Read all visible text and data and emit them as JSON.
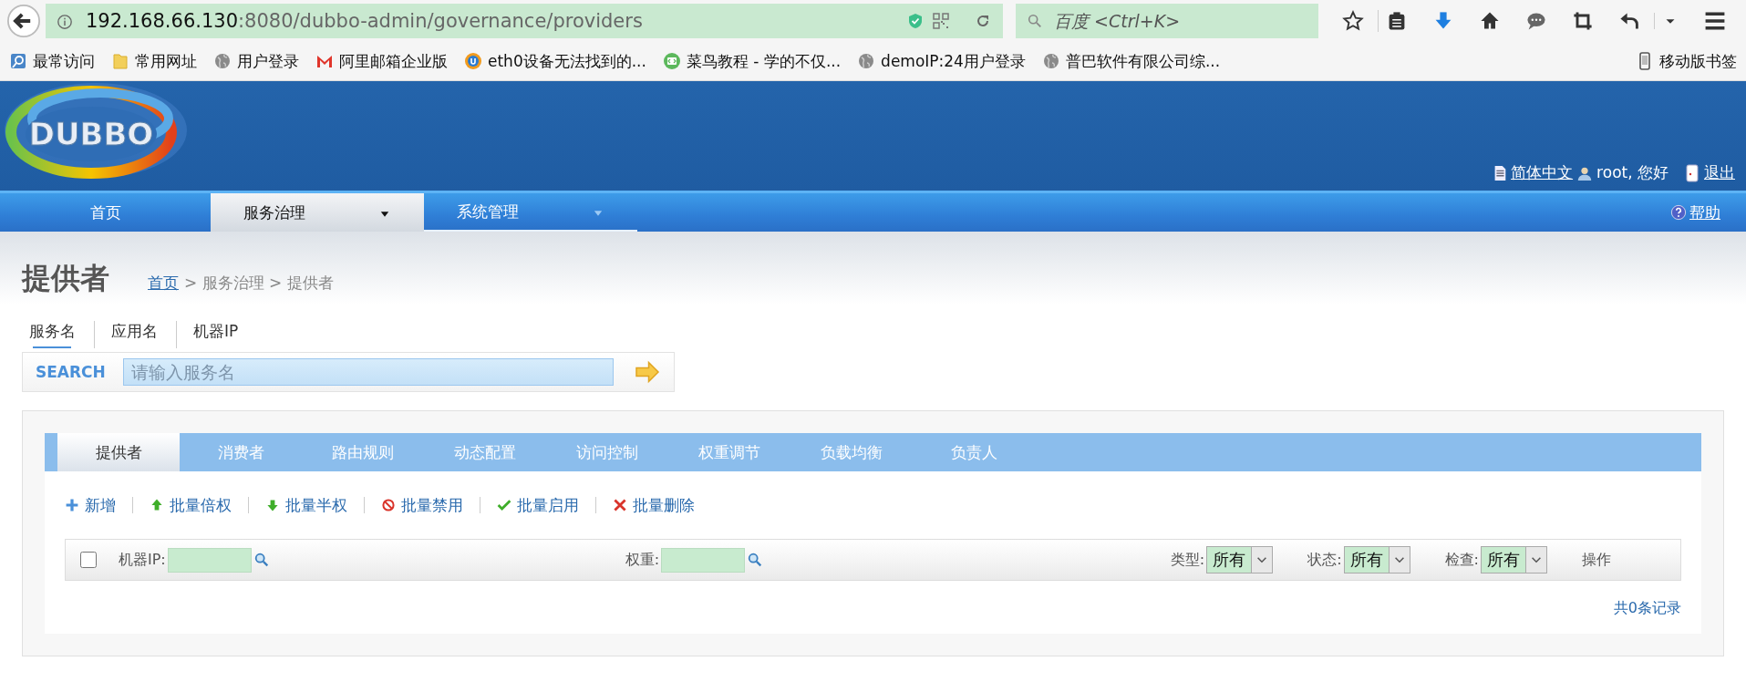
{
  "browser": {
    "url_host": "192.168.66.130",
    "url_rest": ":8080/dubbo-admin/governance/providers",
    "search_placeholder": "百度 <Ctrl+K>",
    "bookmarks": [
      {
        "label": "最常访问",
        "kind": "frequent"
      },
      {
        "label": "常用网址",
        "kind": "folder"
      },
      {
        "label": "用户登录",
        "kind": "globe"
      },
      {
        "label": "阿里邮箱企业版",
        "kind": "mail"
      },
      {
        "label": "eth0设备无法找到的...",
        "kind": "badge"
      },
      {
        "label": "菜鸟教程 - 学的不仅...",
        "kind": "code"
      },
      {
        "label": "demoIP:24用户登录",
        "kind": "globe"
      },
      {
        "label": "普巴软件有限公司综...",
        "kind": "globe"
      }
    ],
    "mobile_bookmarks": "移动版书签"
  },
  "header": {
    "logo": "DUBBO",
    "language": "简体中文",
    "user": "root, 您好",
    "logout": "退出"
  },
  "nav": {
    "items": [
      {
        "label": "首页",
        "selected": false,
        "dropdown": false
      },
      {
        "label": "服务治理",
        "selected": true,
        "dropdown": true
      },
      {
        "label": "系统管理",
        "selected": false,
        "dropdown": true
      }
    ],
    "help": "帮助"
  },
  "page": {
    "title": "提供者",
    "breadcrumb_link": "首页",
    "breadcrumb_rest": "> 服务治理 > 提供者"
  },
  "search": {
    "tabs": [
      {
        "label": "服务名",
        "selected": true
      },
      {
        "label": "应用名",
        "selected": false
      },
      {
        "label": "机器IP",
        "selected": false
      }
    ],
    "label": "SEARCH",
    "placeholder": "请输入服务名"
  },
  "tabs": [
    {
      "label": "提供者",
      "selected": true
    },
    {
      "label": "消费者",
      "selected": false
    },
    {
      "label": "路由规则",
      "selected": false
    },
    {
      "label": "动态配置",
      "selected": false
    },
    {
      "label": "访问控制",
      "selected": false
    },
    {
      "label": "权重调节",
      "selected": false
    },
    {
      "label": "负载均衡",
      "selected": false
    },
    {
      "label": "负责人",
      "selected": false
    }
  ],
  "actions": [
    {
      "label": "新增",
      "kind": "add"
    },
    {
      "label": "批量倍权",
      "kind": "up"
    },
    {
      "label": "批量半权",
      "kind": "down"
    },
    {
      "label": "批量禁用",
      "kind": "disable"
    },
    {
      "label": "批量启用",
      "kind": "enable"
    },
    {
      "label": "批量删除",
      "kind": "delete"
    }
  ],
  "filter": {
    "checked": false,
    "ip_label": "机器IP:",
    "weight_label": "权重:",
    "selects": [
      {
        "label": "类型:",
        "value": "所有"
      },
      {
        "label": "状态:",
        "value": "所有"
      },
      {
        "label": "检查:",
        "value": "所有"
      }
    ],
    "operation": "操作"
  },
  "footer": "共0条记录"
}
